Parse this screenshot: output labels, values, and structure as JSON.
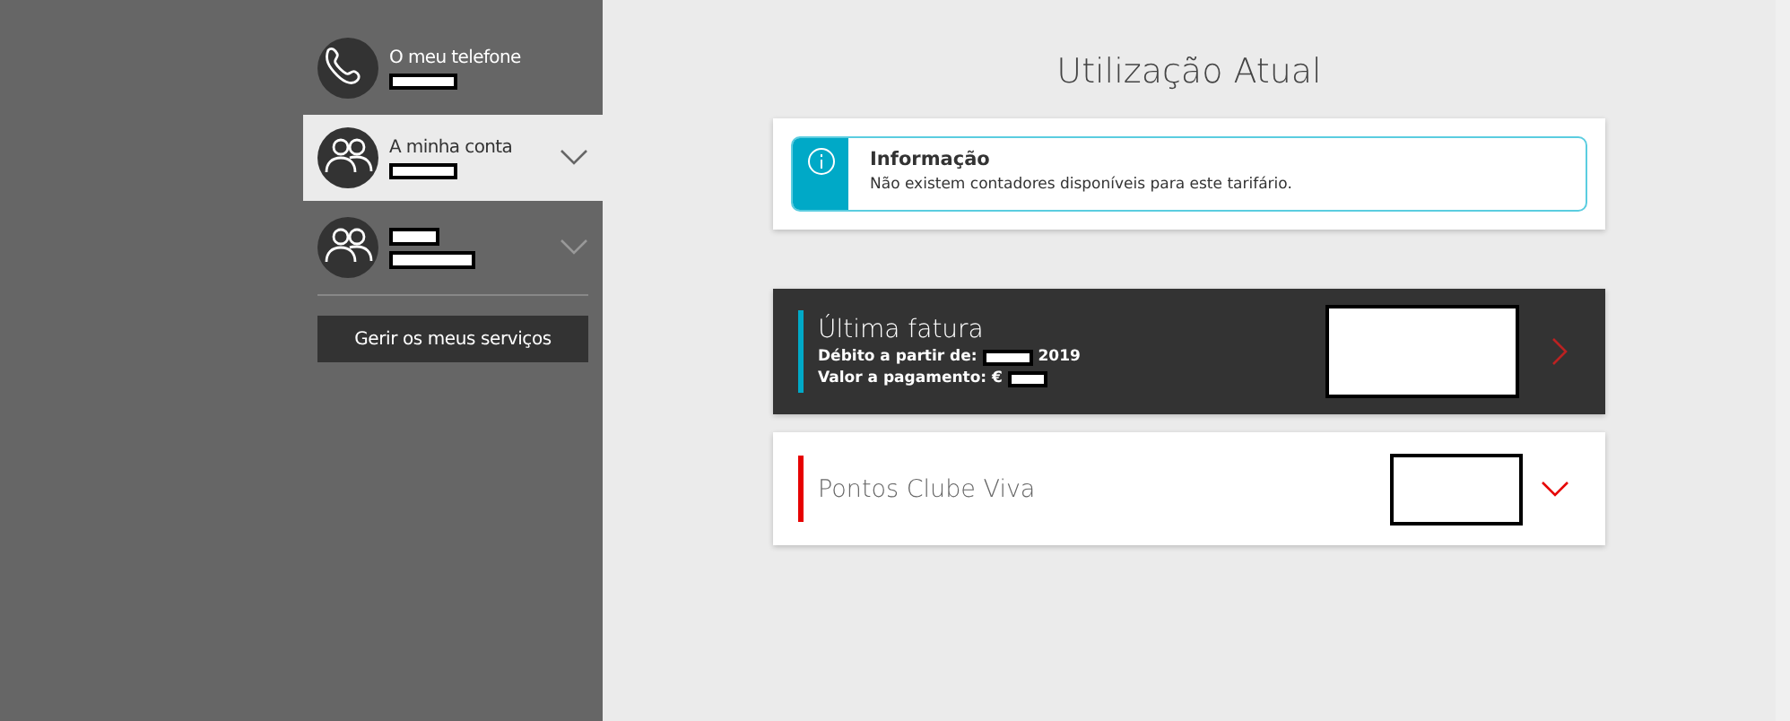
{
  "sidebar": {
    "items": [
      {
        "kind": "phone",
        "label": "O meu telefone",
        "selected": false,
        "expandable": false
      },
      {
        "kind": "people",
        "label": "A minha conta",
        "selected": true,
        "expandable": true
      },
      {
        "kind": "people",
        "selected": false,
        "expandable": true
      }
    ],
    "button": "Gerir os meus serviços"
  },
  "main": {
    "title": "Utilização Atual",
    "info": {
      "title": "Informação",
      "text": "Não existem contadores disponíveis para este tarifário."
    },
    "cards": [
      {
        "kind": "bill",
        "title": "Última fatura",
        "lines": [
          {
            "label": "Débito a partir de:",
            "value": "2019"
          },
          {
            "label": "Valor a pagamento: €"
          }
        ]
      },
      {
        "kind": "points",
        "title": "Pontos Clube Viva"
      }
    ]
  }
}
